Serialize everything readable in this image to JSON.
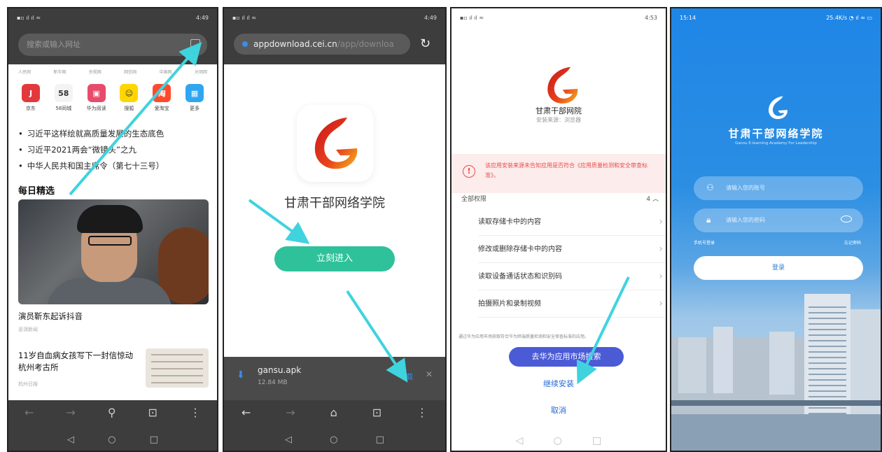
{
  "screens": {
    "browser_home": {
      "search_placeholder": "搜索或输入网址",
      "site_links": [
        "人民网",
        "新华网",
        "央视网",
        "网信网",
        "中国网",
        "光明网"
      ],
      "apps": [
        {
          "label": "京东",
          "icon": "jd-icon",
          "color": "#e4393c",
          "glyph": "J"
        },
        {
          "label": "58同城",
          "icon": "58-icon",
          "color": "#f3f3f3",
          "glyph": "58"
        },
        {
          "label": "华为阅读",
          "icon": "huawei-reading-icon",
          "color": "#e84a6b",
          "glyph": "▣"
        },
        {
          "label": "搜狐",
          "icon": "sohu-icon",
          "color": "#ffd600",
          "glyph": "☺"
        },
        {
          "label": "爱淘宝",
          "icon": "taobao-icon",
          "color": "#ff4a2d",
          "glyph": "淘"
        },
        {
          "label": "更多",
          "icon": "more-apps-icon",
          "color": "#2fa6f0",
          "glyph": "▦"
        }
      ],
      "news": [
        "习近平这样绘就高质量发展的生态底色",
        "习近平2021两会“微镜头”之九",
        "中华人民共和国主席令（第七十三号）"
      ],
      "daily_title": "每日精选",
      "story1_title": "演员靳东起诉抖音",
      "story1_source": "澎湃新闻",
      "story2_title": "11岁自血病女孩写下一封信惊动杭州考古所",
      "story2_source": "杭州日报"
    },
    "download_page": {
      "url_host": "appdownload.cei.cn",
      "url_path": "/app/downloa",
      "app_name": "甘肃干部网络学院",
      "enter_button": "立刻进入",
      "file_name": "gansu.apk",
      "file_size": "12.84 MB",
      "download_action": "下载"
    },
    "install_page": {
      "app_name": "甘肃干部网院",
      "source": "安装来源：浏览器",
      "warning": "该应用安装来源未告知应用是否符合《应用质量检测和安全审查标准》。",
      "permissions_header": "全部权限",
      "permissions_count": "4",
      "permissions": [
        "读取存储卡中的内容",
        "修改或删除存储卡中的内容",
        "读取设备通话状态和识别码",
        "拍摄照片和录制视频"
      ],
      "notice": "通过华为应用市场获取符合华为终端质量检测和安全审查标准的应用。",
      "store_button": "去华为应用市场搜索",
      "continue_button": "继续安装",
      "cancel_button": "取消"
    },
    "login_page": {
      "time": "15:14",
      "status_right": "25.4K/s",
      "title": "甘肃干部网络学院",
      "subtitle": "Gansu E-learning Academy For Leadership",
      "account_placeholder": "请输入您的账号",
      "password_placeholder": "请输入您的密码",
      "sms_login": "手机号登录",
      "forgot_password": "忘记密码",
      "login_button": "登录"
    }
  },
  "status_bar_time": "4:49",
  "status_bar_time_3": "4:53",
  "colors": {
    "accent_green": "#2fc29a",
    "arrow": "#3fd3de",
    "install_blue": "#4b5bd6",
    "login_blue": "#1f86e6"
  }
}
